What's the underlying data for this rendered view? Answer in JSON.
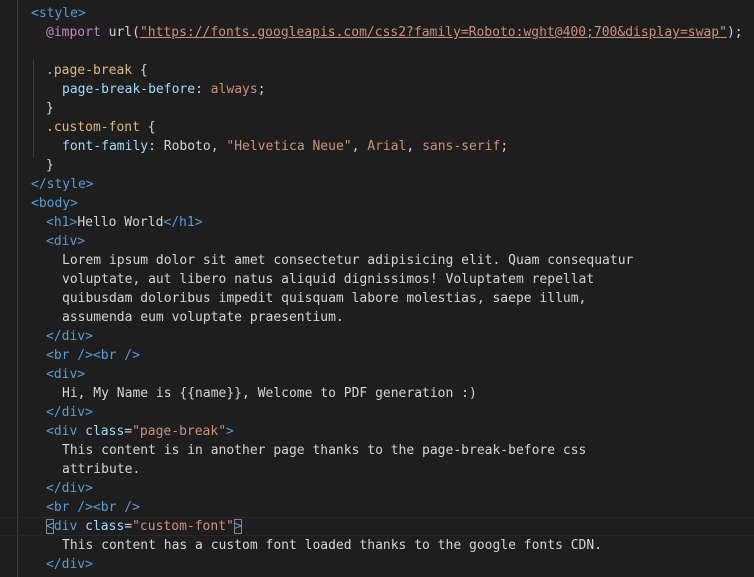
{
  "editor": {
    "colors": {
      "background": "#1e1e1e",
      "tag": "#569cd6",
      "attribute": "#9cdcfe",
      "string": "#ce9178",
      "text": "#d4d4d4",
      "selector": "#d7ba7d",
      "at_rule": "#c586c0"
    },
    "tokens": {
      "style_open": "<style>",
      "at_import": "@import",
      "url_fn": "url(",
      "url_string": "\"https://fonts.googleapis.com/css2?family=Roboto:wght@400;700&display=swap\"",
      "url_close": ");",
      "sel_page_break": ".page-break",
      "brace_open": "{",
      "prop_pbb": "page-break-before",
      "colon": ": ",
      "val_always": "always",
      "semi": ";",
      "brace_close": "}",
      "sel_custom_font": ".custom-font",
      "prop_ff": "font-family",
      "ff_roboto": "Roboto, ",
      "ff_helvetica": "\"Helvetica Neue\"",
      "comma": ", ",
      "ff_arial": "Arial",
      "ff_sans": "sans-serif",
      "style_close": "</style>",
      "body_open": "<body>",
      "h1_open": "<h1>",
      "h1_text": "Hello World",
      "h1_close": "</h1>",
      "div_open": "<div>",
      "lorem_1": "Lorem ipsum dolor sit amet consectetur adipisicing elit. Quam consequatur",
      "lorem_2": "voluptate, aut libero natus aliquid dignissimos! Voluptatem repellat",
      "lorem_3": "quibusdam doloribus impedit quisquam labore molestias, saepe illum,",
      "lorem_4": "assumenda eum voluptate praesentium.",
      "div_close": "</div>",
      "br_br": "<br /><br />",
      "greeting": "Hi, My Name is {{name}}, Welcome to PDF generation :)",
      "div_class_open": "<div ",
      "class_attr": "class",
      "eq": "=",
      "class_page_break": "\"page-break\"",
      "gt": ">",
      "another_page_1": "This content is in another page thanks to the page-break-before css",
      "another_page_2": "attribute.",
      "lt": "<",
      "div_class_open_rest": "div ",
      "class_custom_font": "\"custom-font\"",
      "custom_font_text": "This content has a custom font loaded thanks to the google fonts CDN."
    }
  }
}
